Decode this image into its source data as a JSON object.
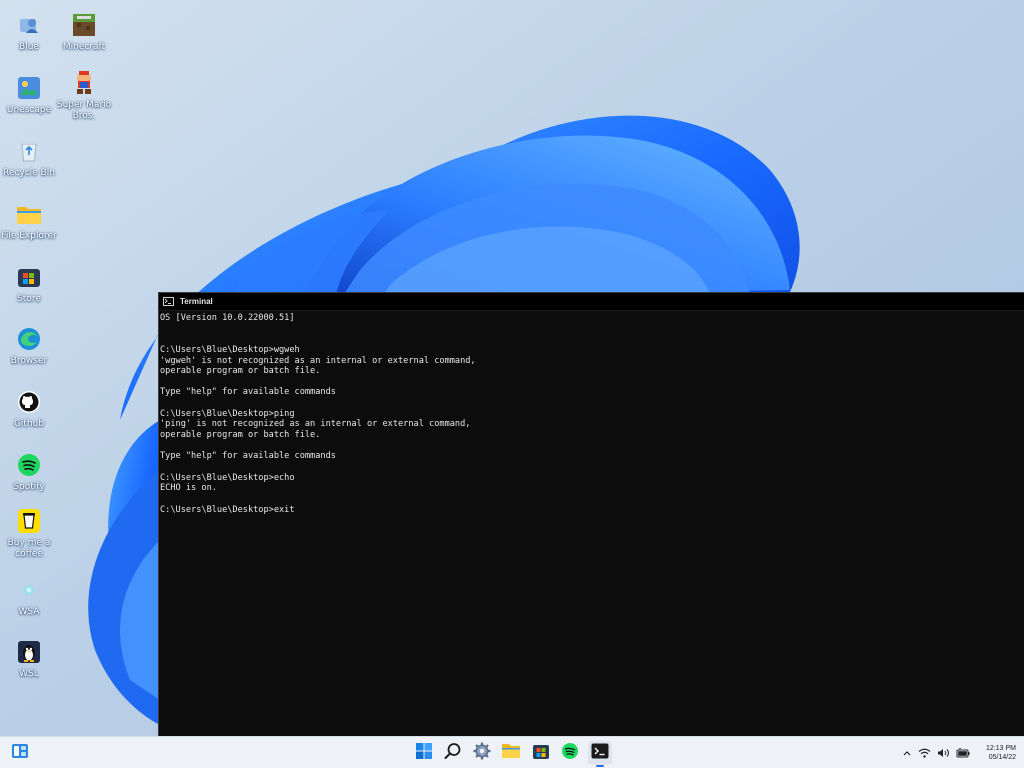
{
  "desktop": {
    "icons": [
      {
        "label": "Blue",
        "icon": "user-folder-icon"
      },
      {
        "label": "Minecraft",
        "icon": "minecraft-icon"
      },
      {
        "label": "Unescape",
        "icon": "unescape-icon"
      },
      {
        "label": "Super Mario Bros.",
        "icon": "mario-icon"
      },
      {
        "label": "Recycle Bin",
        "icon": "recycle-bin-icon"
      },
      {
        "label": "File Explorer",
        "icon": "folder-icon"
      },
      {
        "label": "Store",
        "icon": "store-icon"
      },
      {
        "label": "Browser",
        "icon": "edge-browser-icon"
      },
      {
        "label": "Github",
        "icon": "github-icon"
      },
      {
        "label": "Spotify",
        "icon": "spotify-icon"
      },
      {
        "label": "Buy me a coffee",
        "icon": "coffee-icon"
      },
      {
        "label": "WSA",
        "icon": "wsa-icon"
      },
      {
        "label": "WSL",
        "icon": "linux-penguin-icon"
      }
    ]
  },
  "terminal": {
    "title": "Terminal",
    "lines": [
      "OS [Version 10.0.22000.51]",
      "",
      "",
      "C:\\Users\\Blue\\Desktop>wgweh",
      "'wgweh' is not recognized as an internal or external command,",
      "operable program or batch file.",
      "",
      "Type \"help\" for available commands",
      "",
      "C:\\Users\\Blue\\Desktop>ping",
      "'ping' is not recognized as an internal or external command,",
      "operable program or batch file.",
      "",
      "Type \"help\" for available commands",
      "",
      "C:\\Users\\Blue\\Desktop>echo",
      "ECHO is on.",
      "",
      "C:\\Users\\Blue\\Desktop>exit"
    ]
  },
  "taskbar": {
    "widgets_icon": "widgets-icon",
    "pinned": [
      "start-icon",
      "search-icon",
      "settings-icon",
      "file-explorer-icon",
      "store-icon",
      "spotify-icon",
      "terminal-icon"
    ],
    "tray_icons": [
      "chevron-up-icon",
      "wifi-icon",
      "volume-icon",
      "battery-icon"
    ],
    "clock_time": "12:13 PM",
    "clock_date": "05/14/22"
  },
  "colors": {
    "accent": "#2b6fd6",
    "terminal_bg": "#0c0c0c",
    "taskbar_bg": "#eef2f7"
  }
}
